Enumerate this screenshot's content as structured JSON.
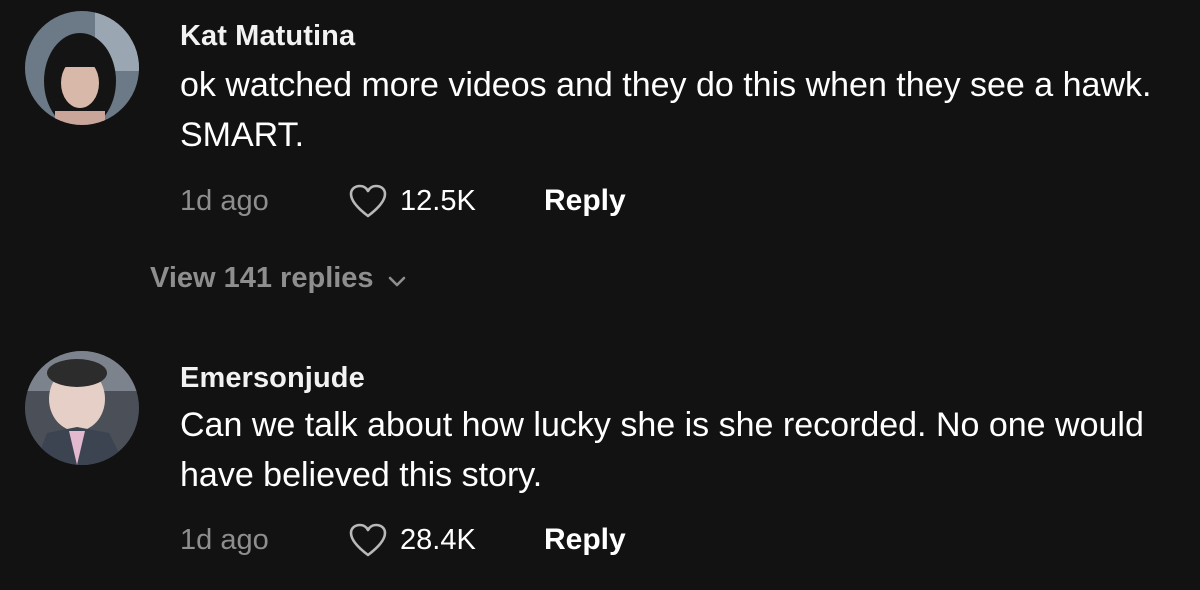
{
  "comments": [
    {
      "username": "Kat Matutina",
      "text": "ok watched more videos and they do this when they see a hawk. SMART.",
      "time": "1d ago",
      "likes": "12.5K",
      "reply_label": "Reply",
      "view_replies": "View 141 replies",
      "avatar_icon": "user-avatar-photo"
    },
    {
      "username": "Emersonjude",
      "text": "Can we talk about how lucky she is she recorded. No one would have believed this story.",
      "time": "1d ago",
      "likes": "28.4K",
      "reply_label": "Reply",
      "avatar_icon": "user-avatar-photo"
    }
  ],
  "colors": {
    "background": "#121212",
    "muted_text": "#8e8e8e",
    "primary_text": "#ffffff"
  }
}
